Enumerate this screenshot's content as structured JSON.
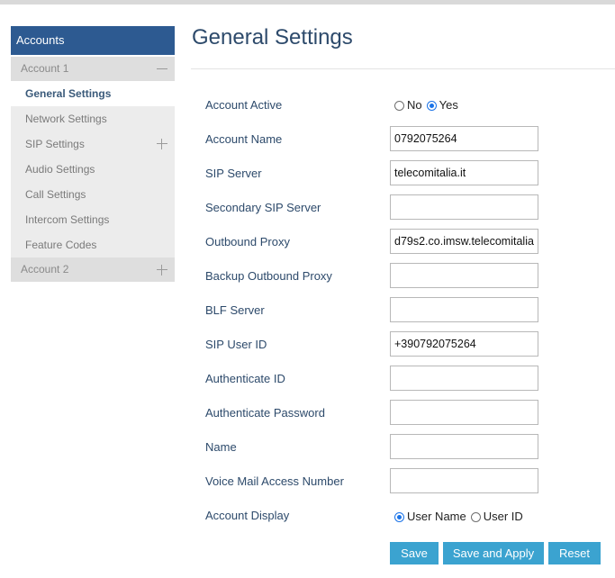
{
  "sidebar": {
    "header": "Accounts",
    "account1": {
      "label": "Account 1"
    },
    "items": [
      {
        "label": "General Settings",
        "active": true
      },
      {
        "label": "Network Settings"
      },
      {
        "label": "SIP Settings"
      },
      {
        "label": "Audio Settings"
      },
      {
        "label": "Call Settings"
      },
      {
        "label": "Intercom Settings"
      },
      {
        "label": "Feature Codes"
      }
    ],
    "account2": {
      "label": "Account 2"
    }
  },
  "main": {
    "title": "General Settings",
    "account_active": {
      "label": "Account Active",
      "options": [
        "No",
        "Yes"
      ],
      "selected": "Yes"
    },
    "fields": [
      {
        "label": "Account Name",
        "value": "0792075264"
      },
      {
        "label": "SIP Server",
        "value": "telecomitalia.it"
      },
      {
        "label": "Secondary SIP Server",
        "value": ""
      },
      {
        "label": "Outbound Proxy",
        "value": "d79s2.co.imsw.telecomitalia"
      },
      {
        "label": "Backup Outbound Proxy",
        "value": ""
      },
      {
        "label": "BLF Server",
        "value": ""
      },
      {
        "label": "SIP User ID",
        "value": "+390792075264"
      },
      {
        "label": "Authenticate ID",
        "value": ""
      },
      {
        "label": "Authenticate Password",
        "value": ""
      },
      {
        "label": "Name",
        "value": ""
      },
      {
        "label": "Voice Mail Access Number",
        "value": ""
      }
    ],
    "account_display": {
      "label": "Account Display",
      "options": [
        "User Name",
        "User ID"
      ],
      "selected": "User Name"
    },
    "buttons": {
      "save": "Save",
      "save_apply": "Save and Apply",
      "reset": "Reset"
    }
  },
  "colors": {
    "sidebar_header_bg": "#2d5a91",
    "button_bg": "#3ba3d0",
    "radio_accent": "#1a73e8",
    "label_text": "#2d4a6b"
  }
}
